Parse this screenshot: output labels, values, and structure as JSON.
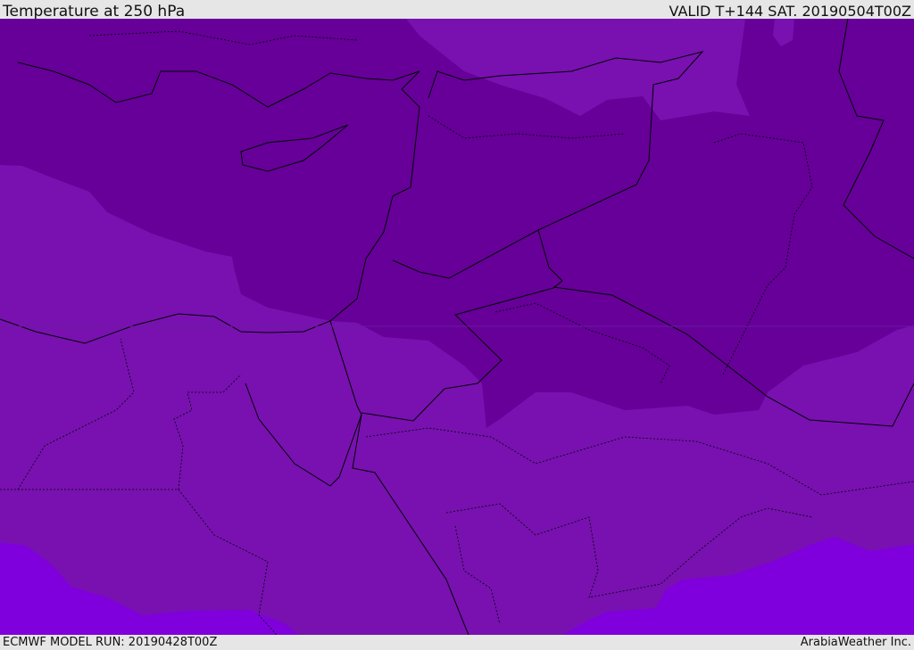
{
  "header": {
    "title": "Temperature at 250 hPa",
    "valid": "VALID T+144 SAT. 20190504T00Z"
  },
  "footer": {
    "model_run": "ECMWF MODEL RUN: 20190428T00Z",
    "credit": "ArabiaWeather Inc."
  },
  "colors": {
    "dark": "#660099",
    "mid": "#7811b0",
    "bright": "#7f00dc",
    "border": "#000000"
  }
}
